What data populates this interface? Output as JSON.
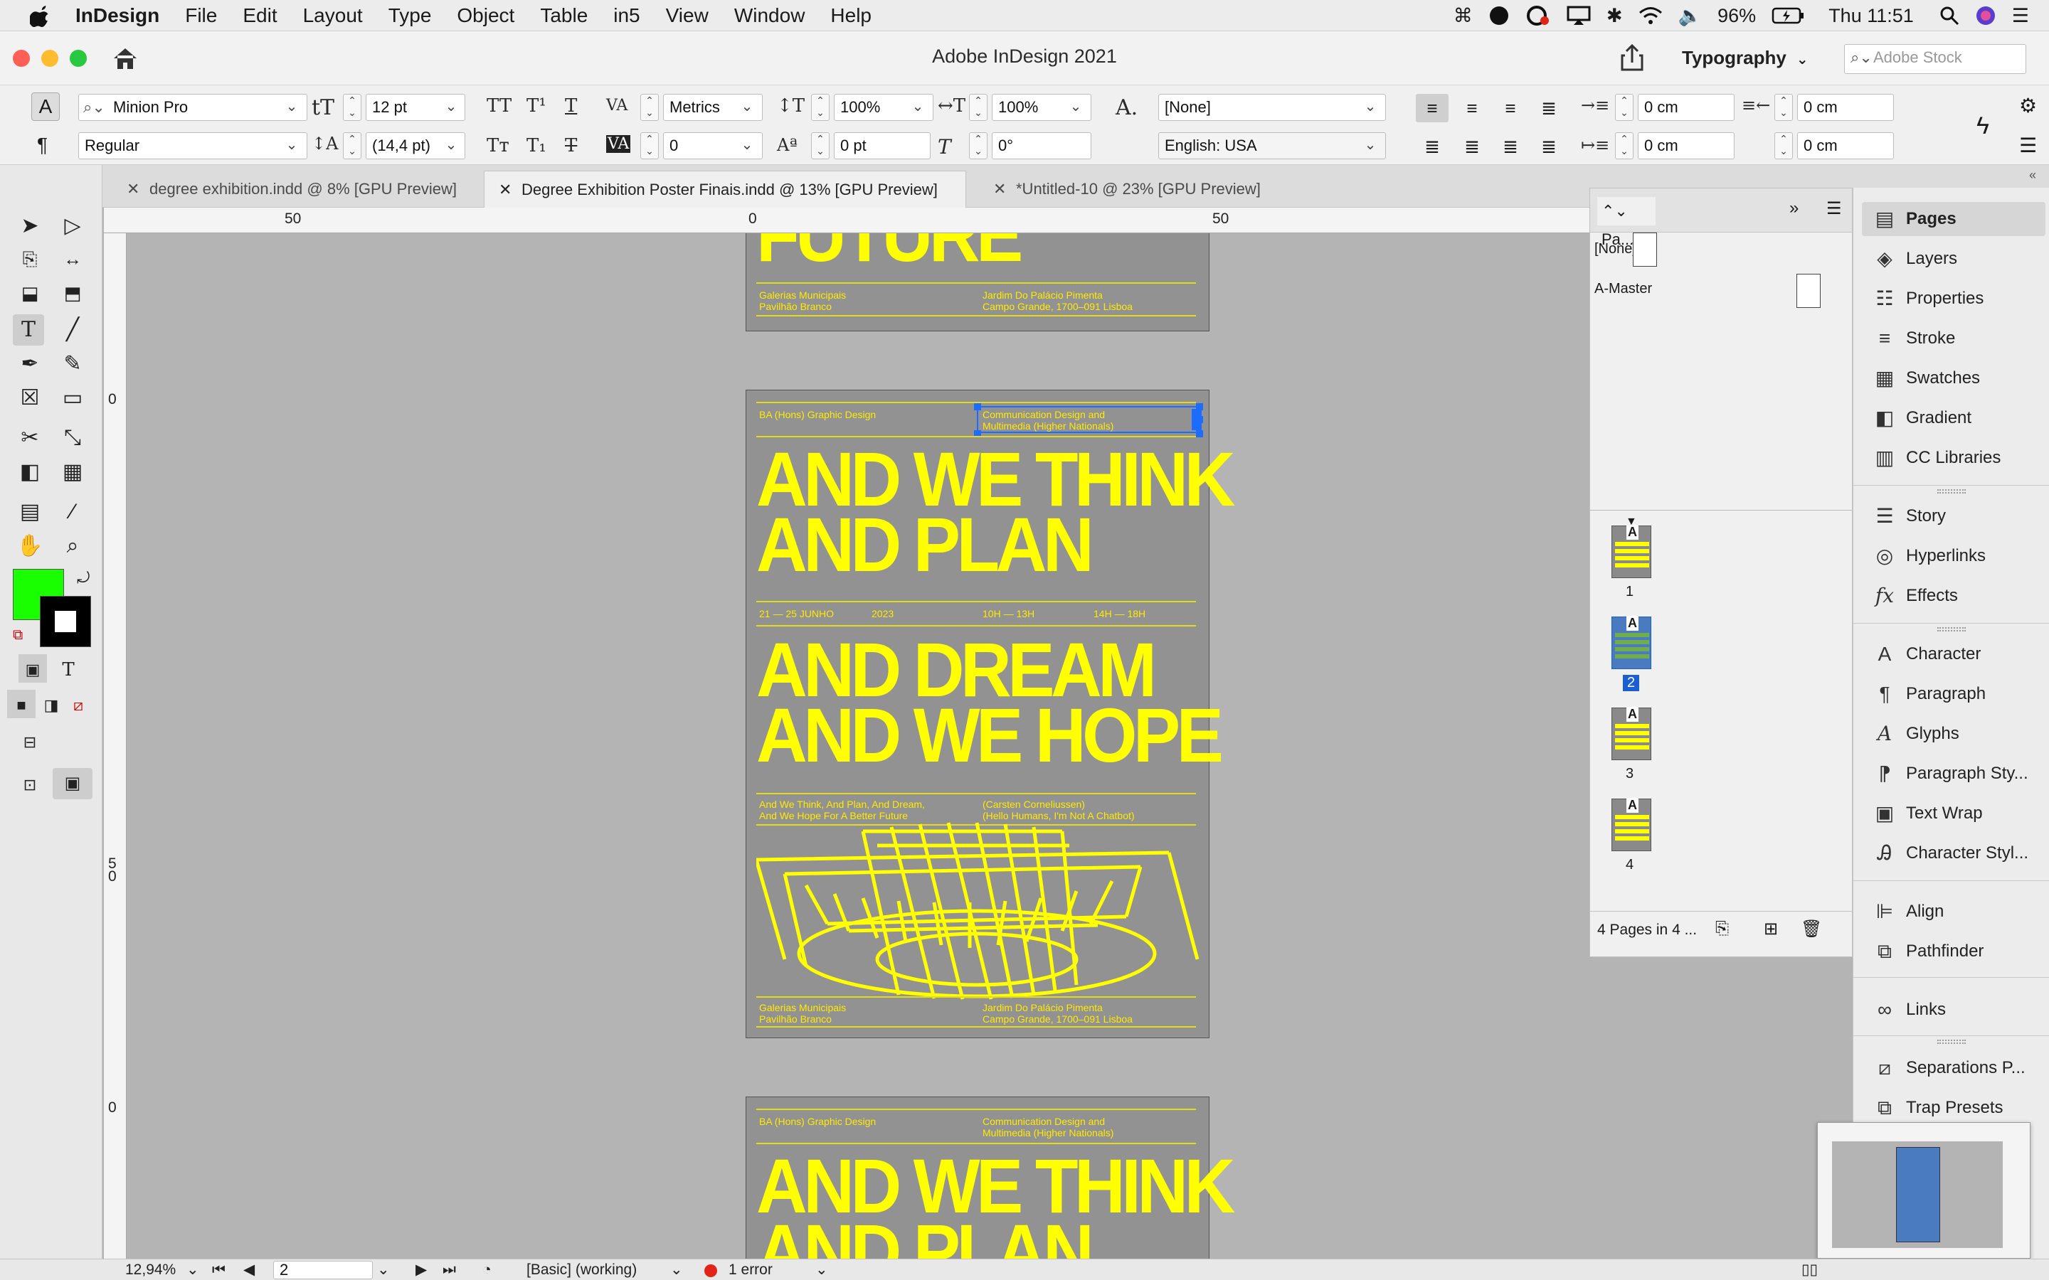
{
  "menubar": {
    "app": "InDesign",
    "items": [
      "File",
      "Edit",
      "Layout",
      "Type",
      "Object",
      "Table",
      "in5",
      "View",
      "Window",
      "Help"
    ],
    "battery": "96%",
    "clock": "Thu 11:51"
  },
  "window": {
    "title": "Adobe InDesign 2021",
    "workspace": "Typography",
    "search_placeholder": "Adobe Stock"
  },
  "control": {
    "font": "Minion Pro",
    "style": "Regular",
    "size": "12 pt",
    "leading": "(14,4 pt)",
    "kerning": "Metrics",
    "tracking": "0",
    "vscale": "100%",
    "hscale": "100%",
    "baseline": "0 pt",
    "skew": "0°",
    "char_style": "[None]",
    "language": "English: USA",
    "indent_left": "0 cm",
    "indent_right": "0 cm",
    "indent_first": "0 cm",
    "indent_last": "0 cm"
  },
  "tabs": [
    {
      "label": "degree exhibition.indd @ 8% [GPU Preview]"
    },
    {
      "label": "Degree Exhibition Poster Finais.indd @ 13% [GPU Preview]"
    },
    {
      "label": "*Untitled-10 @ 23% [GPU Preview]"
    }
  ],
  "ruler": {
    "h": [
      "50",
      "0",
      "50"
    ],
    "v": [
      "0",
      "5\n0",
      "0"
    ]
  },
  "poster": {
    "prev_headline": "FUTURE",
    "venue1": "Galerias Municipais",
    "venue2": "Pavilhão Branco",
    "addr1": "Jardim Do Palácio Pimenta",
    "addr2": "Campo Grande, 1700–091 Lisboa",
    "header_left": "BA (Hons) Graphic Design",
    "header_right1": "Communication Design and",
    "header_right2": "Multimedia (Higher Nationals)",
    "headline1a": "AND WE THINK",
    "headline1b": "AND PLAN",
    "date": "21 — 25 JUNHO",
    "year": "2023",
    "time1": "10H — 13H",
    "time2": "14H — 18H",
    "headline2a": "AND DREAM",
    "headline2b": "AND WE HOPE",
    "credit_left1": "And We Think, And Plan, And Dream,",
    "credit_left2": "And We Hope For A Better Future",
    "credit_right1": "(Carsten Corneliussen)",
    "credit_right2": "(Hello Humans, I'm Not A Chatbot)",
    "next_headline_a": "AND WE THINK",
    "next_headline_b": "AND PLAN"
  },
  "pages_panel": {
    "tab": "Pa...",
    "masters": [
      "[None]",
      "A-Master"
    ],
    "pages": [
      "1",
      "2",
      "3",
      "4"
    ],
    "master_letter": "A",
    "footer": "4 Pages in 4 ..."
  },
  "dock": {
    "items": [
      "Pages",
      "Layers",
      "Properties",
      "Stroke",
      "Swatches",
      "Gradient",
      "CC Libraries",
      "Story",
      "Hyperlinks",
      "Effects",
      "Character",
      "Paragraph",
      "Glyphs",
      "Paragraph Sty...",
      "Text Wrap",
      "Character Styl...",
      "Align",
      "Pathfinder",
      "Links",
      "Separations P...",
      "Trap Presets"
    ]
  },
  "statusbar": {
    "zoom": "12,94%",
    "page": "2",
    "profile": "[Basic] (working)",
    "errors": "1 error"
  },
  "colors": {
    "fill": "#1aff00",
    "stroke": "#000000",
    "poster_bg": "#929292",
    "poster_yellow": "#ffff00"
  }
}
